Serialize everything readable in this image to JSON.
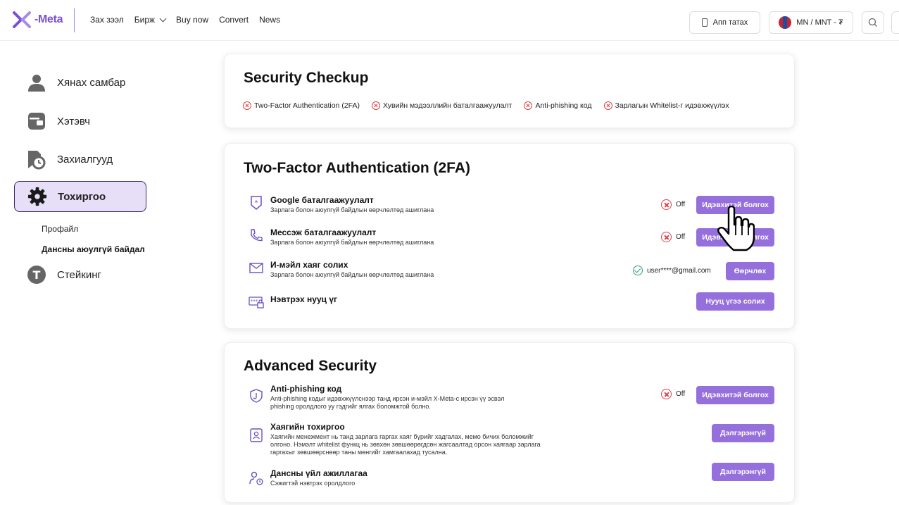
{
  "brand": {
    "logo_text": "-Meta",
    "accent": "#9570dc",
    "brand_purple": "#7b4fd6"
  },
  "nav": {
    "items": [
      "Зах зээл",
      "Бирж",
      "Buy now",
      "Convert",
      "News"
    ]
  },
  "header": {
    "app_button": "Апп татах",
    "lang_currency": "MN / MNT - ₮"
  },
  "sidebar": {
    "items": [
      "Хянах самбар",
      "Хэтэвч",
      "Захиалгууд",
      "Тохиргоо",
      "Стейкинг"
    ],
    "sub_items": [
      "Профайл",
      "Дансны аюулгүй байдал"
    ]
  },
  "checkup": {
    "title": "Security Checkup",
    "items": [
      "Two-Factor Authentication (2FA)",
      "Хувийн мэдээллийн баталгаажуулалт",
      "Anti-phishing код",
      "Зарлагын Whitelist-г идэвхжүүлэх"
    ]
  },
  "tfa": {
    "title": "Two-Factor Authentication (2FA)",
    "rows": [
      {
        "title": "Google баталгаажуулалт",
        "desc": "Зарлага болон аюулгүй байдлын өөрчлөлтөд ашиглана",
        "status": "Off",
        "button": "Идэвхитэй болгох"
      },
      {
        "title": "Мессэж баталгаажуулалт",
        "desc": "Зарлага болон аюулгүй байдлын өөрчлөлтөд ашиглана",
        "status": "Off",
        "button": "Идэвхитэй болгох"
      },
      {
        "title": "И-мэйл хаяг солих",
        "desc": "Зарлага болон аюулгүй байдлын өөрчлөлтөд ашиглана",
        "status": "user****@gmail.com",
        "button": "Өөрчлөх"
      },
      {
        "title": "Нэвтрэх нууц үг",
        "button": "Нууц үгээ солих"
      }
    ]
  },
  "advanced": {
    "title": "Advanced Security",
    "rows": [
      {
        "title": "Anti-phishing код",
        "desc1": "Anti-phishing кодыг идэвхжүүлснээр танд ирсэн и-мэйл X-Meta-с ирсэн үү эсвэл",
        "desc2": "phishing оролдлого уу гэдгийг ялгах боломжтой болно.",
        "status": "Off",
        "button": "Идэвхитэй болгох"
      },
      {
        "title": "Хаягийн тохиргоо",
        "desc1": "Хаягийн менежмент нь танд зарлага гаргах хаяг бүрийг хадгалах, мемо бичих боломжийг",
        "desc2": "олгоно. Нэмэлт whitelist функц нь зөвхөн зөвшөөрөгдсөн жагсаалтад орсон хаягаар зарлага",
        "desc3": "гаргахыг зөвшөөрснөөр таны мөнгийг хамгаалахад тусална.",
        "button": "Дэлгэрэнгүй"
      },
      {
        "title": "Дансны үйл ажиллагаа",
        "desc": "Сэжигтэй нэвтрэх оролдлого",
        "button": "Дэлгэрэнгүй"
      }
    ]
  }
}
